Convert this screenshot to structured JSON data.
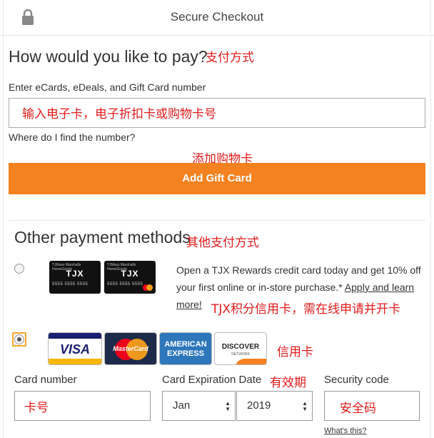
{
  "header": {
    "title": "Secure Checkout"
  },
  "payment": {
    "title": "How would you like to pay?",
    "title_annotation": "支付方式",
    "ecard_label": "Enter eCards, eDeals, and Gift Card number",
    "ecard_annotation": "输入电子卡，电子折扣卡或购物卡号",
    "where_link": "Where do I find the number?",
    "add_annotation": "添加购物卡",
    "add_button": "Add Gift Card",
    "button_color": "#f58220"
  },
  "other": {
    "title": "Other payment methods",
    "title_annotation": "其他支付方式",
    "tjx": {
      "card_brand": "TJX",
      "card_top_text": "TJMaxx Marshalls HomeGoods",
      "card_number": "5555 5555 5555",
      "promo_text": "Open a TJX Rewards credit card today and get 10% off your first online or in-store purchase.*",
      "promo_link": "Apply and learn more!",
      "annotation": "TJX积分信用卡，需在线申请并开卡"
    },
    "credit": {
      "selected": true,
      "logos": [
        "VISA",
        "MasterCard",
        "AMERICAN EXPRESS",
        "DISCOVER"
      ],
      "discover_sub": "NETWORK",
      "annotation": "信用卡"
    }
  },
  "card_form": {
    "number_label": "Card number",
    "number_annotation": "卡号",
    "expiry_label": "Card Expiration Date",
    "expiry_annotation": "有效期",
    "month_value": "Jan",
    "year_value": "2019",
    "security_label": "Security code",
    "security_annotation": "安全码",
    "whats_this": "What's this?"
  },
  "icons": {
    "lock": "lock-icon",
    "select_arrow": "updown-arrow-icon",
    "radio": "radio-button"
  }
}
